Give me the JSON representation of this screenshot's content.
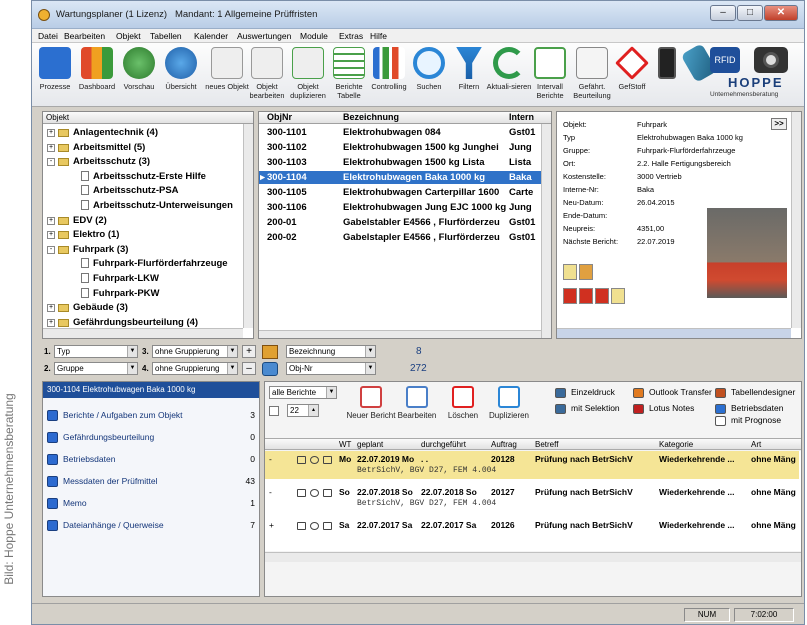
{
  "credit": "Bild: Hoppe Unternehmensberatung",
  "window": {
    "title": "Wartungsplaner (1 Lizenz)",
    "mandant": "Mandant: 1 Allgemeine Prüffristen"
  },
  "menu": [
    "Datei",
    "Bearbeiten",
    "Objekt",
    "Tabellen",
    "Kalender",
    "Auswertungen",
    "Module",
    "Extras",
    "Hilfe"
  ],
  "toolbar": [
    {
      "label": "Prozesse",
      "icon": "process-icon",
      "color": "#2b6fd0"
    },
    {
      "label": "Dashboard",
      "icon": "dashboard-icon",
      "color": "#e04a2a"
    },
    {
      "label": "Vorschau",
      "icon": "preview-globe-icon",
      "color": "#3b9a3b"
    },
    {
      "label": "Übersicht",
      "icon": "overview-icon",
      "color": "#2b86d6"
    },
    {
      "label": "neues Objekt",
      "icon": "new-object-icon",
      "color": "#d8d8d8"
    },
    {
      "label": "Objekt bearbeiten",
      "icon": "edit-object-icon",
      "color": "#d8d8d8"
    },
    {
      "label": "Objekt duplizieren",
      "icon": "duplicate-object-icon",
      "color": "#4aa04a"
    },
    {
      "label": "Berichte Tabelle",
      "icon": "report-table-icon",
      "color": "#4aa04a"
    },
    {
      "label": "Controlling",
      "icon": "controlling-chart-icon",
      "color": "#2b6fd0"
    },
    {
      "label": "Suchen",
      "icon": "search-icon",
      "color": "#2b86d6"
    },
    {
      "label": "Filtern",
      "icon": "filter-icon",
      "color": "#2b86d6"
    },
    {
      "label": "Aktuali-sieren",
      "icon": "refresh-icon",
      "color": "#2f9a4a"
    },
    {
      "label": "Intervall Berichte",
      "icon": "interval-report-icon",
      "color": "#4aa04a"
    },
    {
      "label": "Gefährt. Beurteilung",
      "icon": "hazard-assessment-icon",
      "color": "#c8c8c8"
    },
    {
      "label": "GefStoff",
      "icon": "hazardous-substance-icon",
      "color": "#e02020"
    },
    {
      "label": "",
      "icon": "mobile-phone-icon",
      "color": "#333"
    },
    {
      "label": "",
      "icon": "barcode-scanner-icon",
      "color": "#4aa0c8"
    },
    {
      "label": "",
      "icon": "rfid-icon",
      "color": "#1f4f9a"
    }
  ],
  "brand": {
    "name": "HOPPE",
    "tagline": "Unternehmensberatung",
    "camera_icon": "camera-icon"
  },
  "tree": {
    "header": "Objekt",
    "items": [
      {
        "label": "Anlagentechnik  (4)",
        "level": 0,
        "type": "folder",
        "expand": "+"
      },
      {
        "label": "Arbeitsmittel  (5)",
        "level": 0,
        "type": "folder",
        "expand": "+"
      },
      {
        "label": "Arbeitsschutz  (3)",
        "level": 0,
        "type": "folder",
        "expand": "-"
      },
      {
        "label": "Arbeitsschutz-Erste Hilfe",
        "level": 1,
        "type": "doc"
      },
      {
        "label": "Arbeitsschutz-PSA",
        "level": 1,
        "type": "doc"
      },
      {
        "label": "Arbeitsschutz-Unterweisungen",
        "level": 1,
        "type": "doc"
      },
      {
        "label": "EDV  (2)",
        "level": 0,
        "type": "folder",
        "expand": "+"
      },
      {
        "label": "Elektro  (1)",
        "level": 0,
        "type": "folder",
        "expand": "+"
      },
      {
        "label": "Fuhrpark  (3)",
        "level": 0,
        "type": "folder",
        "expand": "-"
      },
      {
        "label": "Fuhrpark-Flurförderfahrzeuge",
        "level": 1,
        "type": "doc"
      },
      {
        "label": "Fuhrpark-LKW",
        "level": 1,
        "type": "doc"
      },
      {
        "label": "Fuhrpark-PKW",
        "level": 1,
        "type": "doc"
      },
      {
        "label": "Gebäude  (3)",
        "level": 0,
        "type": "folder",
        "expand": "+"
      },
      {
        "label": "Gefährdungsbeurteilung  (4)",
        "level": 0,
        "type": "folder",
        "expand": "+"
      }
    ]
  },
  "grid": {
    "columns": [
      "ObjNr",
      "Bezeichnung",
      "Intern"
    ],
    "rows": [
      {
        "nr": "300-1101",
        "bez": "Elektrohubwagen 084",
        "intern": "Gst01",
        "selected": false
      },
      {
        "nr": "300-1102",
        "bez": "Elektrohubwagen 1500 kg  Junghei",
        "intern": "Jung",
        "selected": false
      },
      {
        "nr": "300-1103",
        "bez": "Elektrohubwagen 1500 kg Lista",
        "intern": "Lista",
        "selected": false
      },
      {
        "nr": "300-1104",
        "bez": "Elektrohubwagen Baka 1000 kg",
        "intern": "Baka",
        "selected": true
      },
      {
        "nr": "300-1105",
        "bez": "Elektrohubwagen Carterpillar 1600",
        "intern": "Carte",
        "selected": false
      },
      {
        "nr": "300-1106",
        "bez": "Elektrohubwagen Jung EJC 1000 kg",
        "intern": "Jung",
        "selected": false
      },
      {
        "nr": "200-01",
        "bez": "Gabelstabler E4566 , Flurförderzeu",
        "intern": "Gst01",
        "selected": false
      },
      {
        "nr": "200-02",
        "bez": "Gabelstapler E4566 , Flurförderzeu",
        "intern": "Gst01",
        "selected": false
      }
    ]
  },
  "details": {
    "expand_label": ">>",
    "fields": [
      {
        "key": "Objekt:",
        "value": "Fuhrpark"
      },
      {
        "key": "Typ",
        "value": "Elektrohubwagen Baka 1000 kg"
      },
      {
        "key": "Gruppe:",
        "value": "Fuhrpark-Flurförderfahrzeuge"
      },
      {
        "key": "Ort:",
        "value": "2.2. Halle Fertigungsbereich"
      },
      {
        "key": "Kostenstelle:",
        "value": "3000 Vertrieb"
      },
      {
        "key": "Interne-Nr:",
        "value": "Baka"
      },
      {
        "key": "Neu-Datum:",
        "value": "26.04.2015"
      },
      {
        "key": "Ende-Datum:",
        "value": ""
      },
      {
        "key": "Neupreis:",
        "value": "4351,00"
      },
      {
        "key": "Nächste Bericht:",
        "value": "22.07.2019"
      }
    ]
  },
  "grouping": {
    "row1": {
      "num": "1.",
      "field": "Typ",
      "num3": "3.",
      "group": "ohne Gruppierung",
      "sort": "Bezeichnung",
      "count": "8"
    },
    "row2": {
      "num": "2.",
      "field": "Gruppe",
      "num4": "4.",
      "group": "ohne Gruppierung",
      "sort": "Obj-Nr",
      "count": "272"
    }
  },
  "left_panel": {
    "selected_title": "300-1104 Elektrohubwagen Baka 1000 kg",
    "items": [
      {
        "label": "Berichte / Aufgaben zum Objekt",
        "count": "3"
      },
      {
        "label": "Gefährdungsbeurteilung",
        "count": "0"
      },
      {
        "label": "Betriebsdaten",
        "count": "0"
      },
      {
        "label": "Messdaten der Prüfmittel",
        "count": "43"
      },
      {
        "label": "Memo",
        "count": "1"
      },
      {
        "label": "Dateianhänge / Querweise",
        "count": "7"
      }
    ]
  },
  "reports": {
    "filter": "alle Berichte",
    "days": "22",
    "actions": [
      {
        "label": "Neuer Bericht",
        "icon": "new-report-icon",
        "color": "#d04040"
      },
      {
        "label": "Bearbeiten",
        "icon": "edit-report-icon",
        "color": "#4a7fc8"
      },
      {
        "label": "Löschen",
        "icon": "delete-icon",
        "color": "#e02020"
      },
      {
        "label": "Duplizieren",
        "icon": "duplicate-icon",
        "color": "#2b86d6"
      }
    ],
    "links": [
      {
        "label": "Einzeldruck",
        "icon": "printer-icon",
        "color": "#3a6a9a"
      },
      {
        "label": "mit Selektion",
        "icon": "printer-selection-icon",
        "color": "#3a6a9a"
      },
      {
        "label": "Outlook Transfer",
        "icon": "outlook-icon",
        "color": "#e07a20"
      },
      {
        "label": "Lotus Notes",
        "icon": "lotus-notes-icon",
        "color": "#c02020"
      },
      {
        "label": "Tabellendesigner",
        "icon": "table-designer-icon",
        "color": "#c05020"
      },
      {
        "label": "Betriebsdaten",
        "icon": "operating-data-icon",
        "color": "#2b6fd0"
      },
      {
        "label": "mit Prognose",
        "icon": "forecast-checkbox",
        "color": "#ffffff"
      }
    ],
    "columns": [
      "WT",
      "geplant",
      "durchgeführt",
      "Auftrag",
      "Betreff",
      "Kategorie",
      "Art"
    ],
    "rows": [
      {
        "wt": "Mo",
        "geplant": "22.07.2019 Mo",
        "durch": ". .",
        "auftrag": "20128",
        "betreff": "Prüfung nach BetrSichV",
        "kategorie": "Wiederkehrende ...",
        "art": "ohne Mäng",
        "detail": "BetrSichV, BGV D27, FEM 4.004",
        "highlight": true,
        "expand": "-"
      },
      {
        "wt": "So",
        "geplant": "22.07.2018 So",
        "durch": "22.07.2018 So",
        "auftrag": "20127",
        "betreff": "Prüfung nach BetrSichV",
        "kategorie": "Wiederkehrende ...",
        "art": "ohne Mäng",
        "detail": "BetrSichV, BGV D27, FEM 4.004",
        "highlight": false,
        "expand": "-"
      },
      {
        "wt": "Sa",
        "geplant": "22.07.2017 Sa",
        "durch": "22.07.2017 Sa",
        "auftrag": "20126",
        "betreff": "Prüfung nach BetrSichV",
        "kategorie": "Wiederkehrende ...",
        "art": "ohne Mäng",
        "detail": "",
        "highlight": false,
        "expand": "+"
      }
    ]
  },
  "status": {
    "mode": "NUM",
    "time": "7:02:00"
  }
}
